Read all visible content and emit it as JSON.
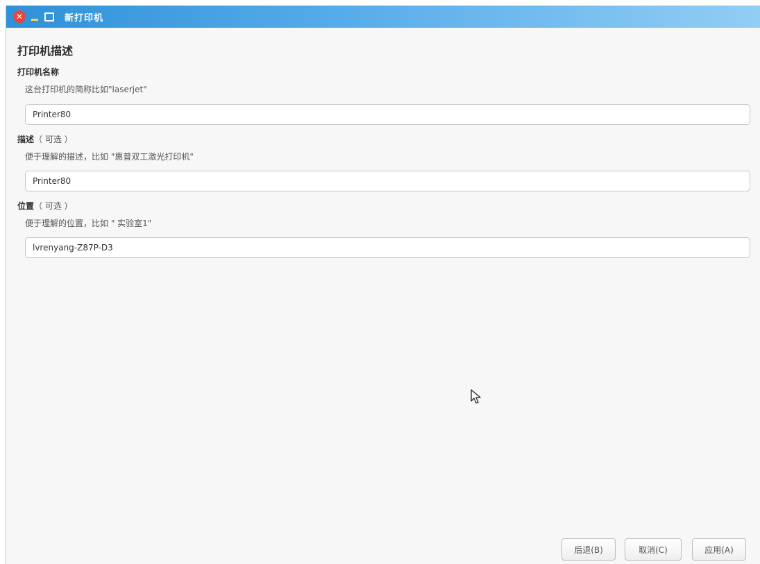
{
  "window": {
    "title": "新打印机",
    "close_glyph": "✕"
  },
  "page": {
    "heading": "打印机描述"
  },
  "name_section": {
    "title": "打印机名称",
    "hint": "这台打印机的简称比如\"laserjet\"",
    "value": "Printer80"
  },
  "description_section": {
    "title": "描述",
    "optional": "（ 可选 ）",
    "hint": "便于理解的描述，比如 \"惠普双工激光打印机\"",
    "value": "Printer80"
  },
  "location_section": {
    "title": "位置",
    "optional": "（ 可选 ）",
    "hint": "便于理解的位置，比如 \" 实验室1\"",
    "value": "lvrenyang-Z87P-D3"
  },
  "buttons": {
    "back": "后退(B)",
    "cancel": "取消(C)",
    "apply": "应用(A)"
  },
  "colors": {
    "titlebar_start": "#2f91d8",
    "titlebar_end": "#92cdf4",
    "close": "#e5473c",
    "minimize": "#ffd54a"
  },
  "icons": [
    "close-icon",
    "minimize-icon",
    "maximize-icon",
    "mouse-pointer-icon"
  ]
}
